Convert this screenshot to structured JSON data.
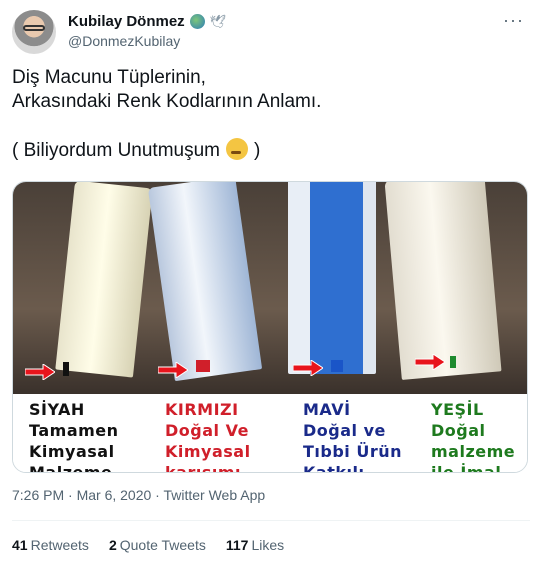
{
  "author": {
    "name": "Kubilay Dönmez",
    "handle": "@DonmezKubilay"
  },
  "more_glyph": "···",
  "tweet": {
    "line1": "Diş Macunu Tüplerinin,",
    "line2": "Arkasındaki Renk Kodlarının Anlamı.",
    "line3_open": "( Biliyordum Unutmuşum",
    "line3_close": ")"
  },
  "image": {
    "columns": [
      {
        "title": "SİYAH",
        "lines": [
          "Tamamen",
          "Kimyasal",
          "Malzeme"
        ],
        "color": "#111111"
      },
      {
        "title": "KIRMIZI",
        "lines": [
          "Doğal Ve",
          "Kimyasal",
          "karışımı"
        ],
        "color": "#d01f2a"
      },
      {
        "title": "MAVİ",
        "lines": [
          "Doğal ve",
          "Tıbbi Ürün",
          "Katkılı"
        ],
        "color": "#1a2a8a"
      },
      {
        "title": "YEŞİL",
        "lines": [
          "Doğal",
          "malzeme",
          "ile İmal"
        ],
        "color": "#1e7a1e"
      }
    ],
    "tube_marks": [
      "#111111",
      "#d01f2a",
      "#1a55c8",
      "#1e8a2e"
    ],
    "arrow_color": "#e8141c"
  },
  "meta": {
    "time": "7:26 PM · Mar 6, 2020 · Twitter Web App"
  },
  "stats": {
    "retweets_count": "41",
    "retweets_label": "Retweets",
    "quotes_count": "2",
    "quotes_label": "Quote Tweets",
    "likes_count": "117",
    "likes_label": "Likes"
  }
}
